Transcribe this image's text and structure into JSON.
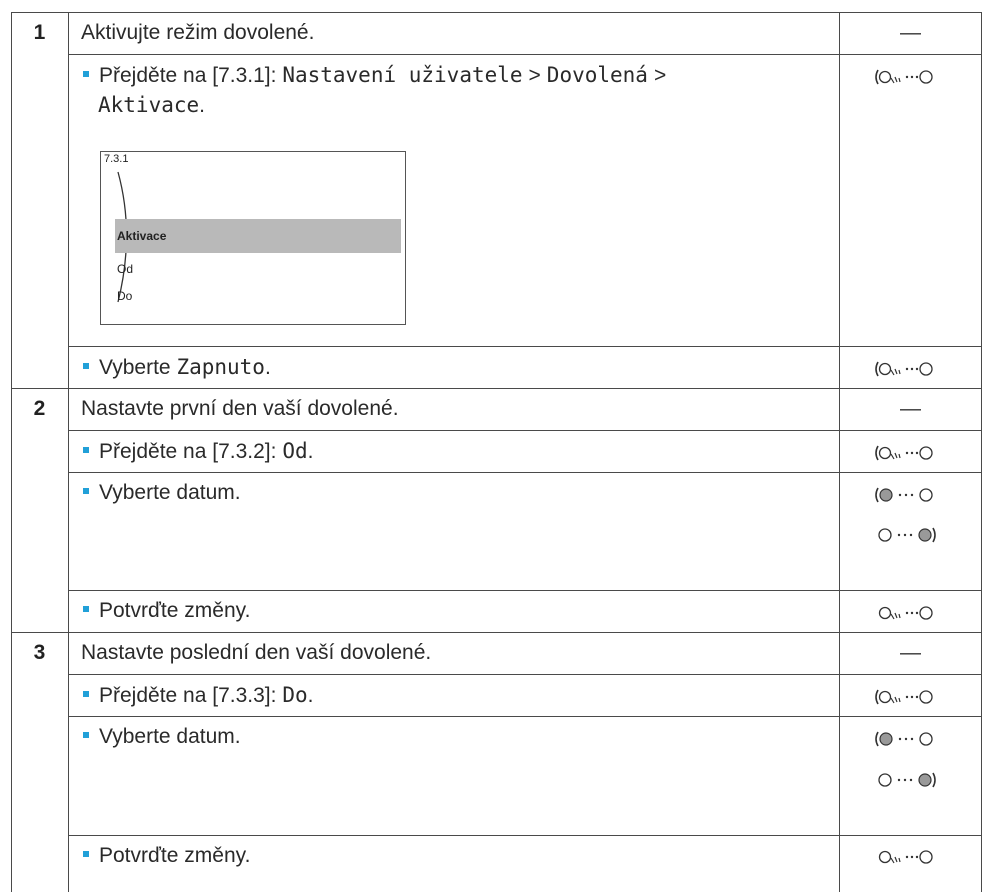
{
  "steps": [
    {
      "number": "1",
      "title": "Aktivujte režim dovolené.",
      "dash": "—",
      "substep1": {
        "prefix": "Přejděte na [7.3.1]:",
        "path1": "Nastavení uživatele",
        "sep1": ">",
        "path2": "Dovolená",
        "sep2": ">",
        "path3": "Aktivace",
        "end": "."
      },
      "screen": {
        "id": "7.3.1",
        "selected": "Aktivace",
        "item2": "Od",
        "item3": "Do"
      },
      "substep2": {
        "prefix": "Vyberte",
        "value": "Zapnuto",
        "end": "."
      }
    },
    {
      "number": "2",
      "title": "Nastavte první den vaší dovolené.",
      "dash": "—",
      "substep1": {
        "prefix": "Přejděte na [7.3.2]:",
        "value": "Od",
        "end": "."
      },
      "substep2": "Vyberte datum.",
      "substep3": "Potvrďte změny."
    },
    {
      "number": "3",
      "title": "Nastavte poslední den vaší dovolené.",
      "dash": "—",
      "substep1": {
        "prefix": "Přejděte na [7.3.3]:",
        "value": "Do",
        "end": "."
      },
      "substep2": "Vyberte datum.",
      "substep3": "Potvrďte změny."
    }
  ],
  "icons": {
    "press_turn_left": "left-dial-press-turn-icon",
    "turn_left": "left-dial-turn-icon",
    "turn_right": "right-dial-turn-icon",
    "press_left": "left-dial-press-icon"
  },
  "colors": {
    "bullet": "#21a0d8",
    "selection": "#b9b9b9",
    "border": "#4a4a4a"
  }
}
